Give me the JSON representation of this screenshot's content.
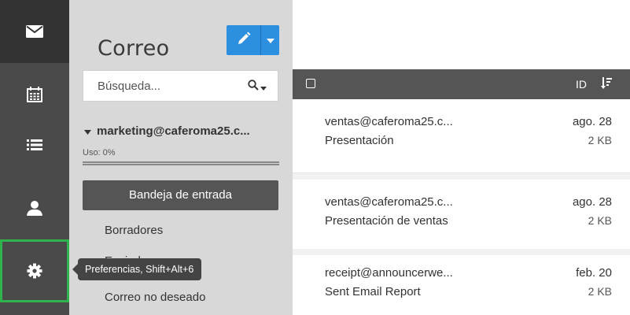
{
  "app": {
    "title": "Correo"
  },
  "iconbar": {
    "items": [
      {
        "icon": "envelope-icon",
        "active": true
      },
      {
        "icon": "calendar-icon"
      },
      {
        "icon": "list-icon"
      },
      {
        "icon": "user-icon"
      },
      {
        "icon": "gear-icon",
        "selected": true
      }
    ]
  },
  "search": {
    "placeholder": "Búsqueda..."
  },
  "account": {
    "name": "marketing@caferoma25.c...",
    "usage_label": "Uso: 0%",
    "usage_percent": 0
  },
  "folders": [
    {
      "label": "Bandeja de entrada",
      "selected": true
    },
    {
      "label": "Borradores"
    },
    {
      "label": "Enviados"
    },
    {
      "label": "Correo no deseado"
    }
  ],
  "tooltip": {
    "text": "Preferencias, Shift+Alt+6"
  },
  "list_header": {
    "sort_label": "ID"
  },
  "messages": [
    {
      "from": "ventas@caferoma25.c...",
      "date": "ago. 28",
      "subject": "Presentación",
      "size": "2 KB"
    },
    {
      "from": "ventas@caferoma25.c...",
      "date": "ago. 28",
      "subject": "Presentación de ventas",
      "size": "2 KB"
    },
    {
      "from": "receipt@announcerwe...",
      "date": "feb. 20",
      "subject": "Sent Email Report",
      "size": "2 KB"
    }
  ],
  "colors": {
    "accent": "#2d8fe0",
    "sidebar": "#4a4a4a",
    "selection_outline": "#2fb34a",
    "panel": "#d8d8d8"
  }
}
